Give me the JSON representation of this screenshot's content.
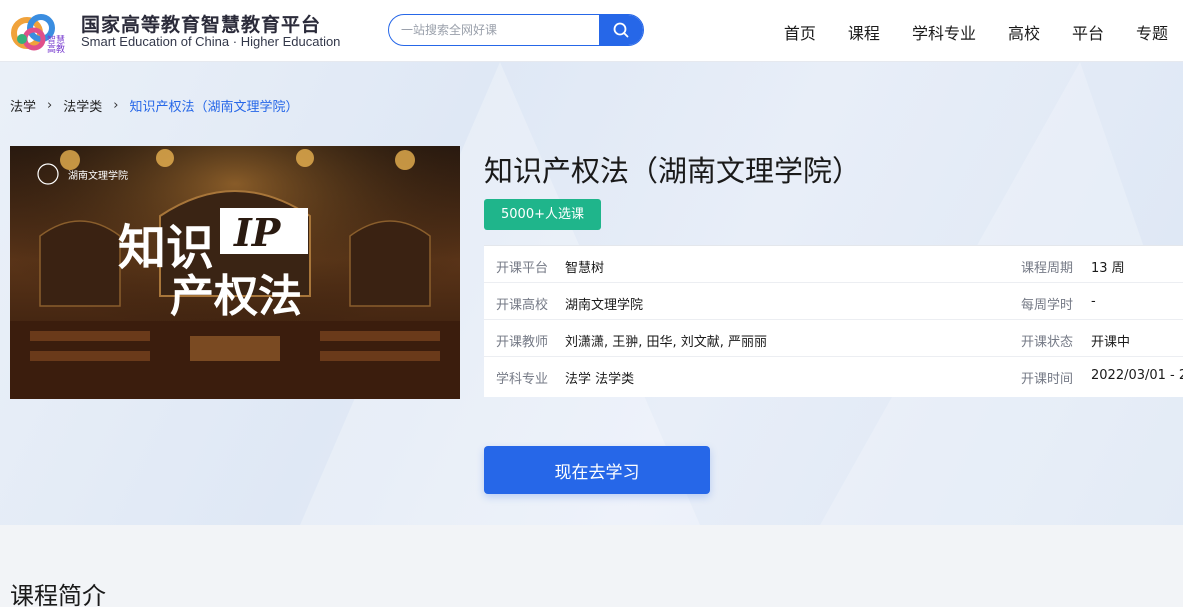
{
  "header": {
    "brand_cn": "国家高等教育智慧教育平台",
    "brand_en": "Smart Education of China · Higher Education",
    "logo_text_line1": "智慧",
    "logo_text_line2": "高教",
    "search_placeholder": "一站搜索全网好课",
    "nav": [
      "首页",
      "课程",
      "学科专业",
      "高校",
      "平台",
      "专题"
    ]
  },
  "breadcrumb": {
    "items": [
      "法学",
      "法学类"
    ],
    "current": "知识产权法（湖南文理学院）",
    "separator": "›"
  },
  "course": {
    "title": "知识产权法（湖南文理学院）",
    "enrollment_badge": "5000+人选课",
    "cover": {
      "school_mark": "湖南文理学院",
      "title_line1": "知识",
      "title_ip": "IP",
      "title_line2": "产权法"
    },
    "info": [
      {
        "k1": "开课平台",
        "v1": "智慧树",
        "k2": "课程周期",
        "v2": "13 周"
      },
      {
        "k1": "开课高校",
        "v1": "湖南文理学院",
        "k2": "每周学时",
        "v2": "-"
      },
      {
        "k1": "开课教师",
        "v1": "刘潇潇, 王翀, 田华, 刘文献, 严丽丽",
        "k2": "开课状态",
        "v2": "开课中"
      },
      {
        "k1": "学科专业",
        "v1": "法学 法学类",
        "k2": "开课时间",
        "v2": "2022/03/01 - 2"
      }
    ],
    "study_button": "现在去学习"
  },
  "section": {
    "intro_title": "课程简介"
  },
  "colors": {
    "accent": "#2667e8",
    "badge": "#1fb58b"
  }
}
